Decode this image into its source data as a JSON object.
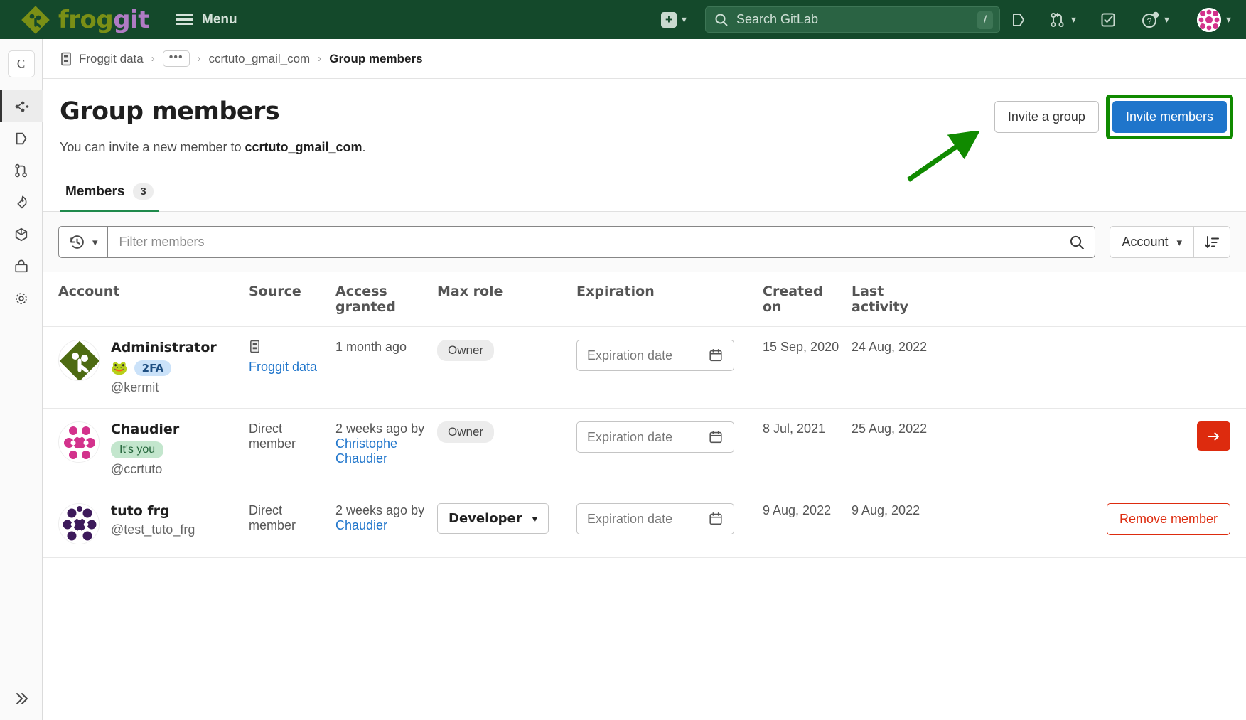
{
  "navbar": {
    "brand_frog": "frog",
    "brand_git": "git",
    "menu_label": "Menu",
    "new_icon": "plus-square-icon",
    "search_placeholder": "Search GitLab",
    "search_value": "",
    "search_shortcut": "/",
    "icons": {
      "issues": "issues-icon",
      "merge_requests": "merge-request-icon",
      "todos": "todo-checkbox-icon",
      "help": "help-question-icon",
      "user_avatar": "user-avatar"
    }
  },
  "sidebar": {
    "context_avatar_letter": "C",
    "items": [
      {
        "name": "group-overview",
        "icon": "group-overview-icon",
        "active": true
      },
      {
        "name": "issues",
        "icon": "issues-icon",
        "active": false
      },
      {
        "name": "merge-requests",
        "icon": "merge-request-icon",
        "active": false
      },
      {
        "name": "ci-cd",
        "icon": "rocket-icon",
        "active": false
      },
      {
        "name": "kubernetes",
        "icon": "package-cube-icon",
        "active": false
      },
      {
        "name": "packages-registries",
        "icon": "package-box-icon",
        "active": false
      },
      {
        "name": "settings",
        "icon": "gear-icon",
        "active": false
      }
    ],
    "collapse_icon": "chevron-double-right-icon"
  },
  "breadcrumb": {
    "icon": "group-icon",
    "items": [
      {
        "label": "Froggit data",
        "current": false
      },
      {
        "label": "•••",
        "current": false,
        "is_ellipsis": true
      },
      {
        "label": "ccrtuto_gmail_com",
        "current": false
      },
      {
        "label": "Group members",
        "current": true
      }
    ],
    "separator": "›"
  },
  "page": {
    "title": "Group members",
    "subtitle_prefix": "You can invite a new member to ",
    "subtitle_group": "ccrtuto_gmail_com",
    "subtitle_suffix": ".",
    "invite_group_label": "Invite a group",
    "invite_members_label": "Invite members",
    "invite_members_color": "#1f75cb",
    "highlight_color": "#108a00"
  },
  "tabs": [
    {
      "label": "Members",
      "count": "3",
      "active": true
    }
  ],
  "filter": {
    "history_icon": "history-clock-icon",
    "placeholder": "Filter members",
    "value": "",
    "search_icon": "search-icon",
    "sort_label": "Account",
    "sort_direction_icon": "sort-descending-icon"
  },
  "table": {
    "columns": [
      "Account",
      "Source",
      "Access granted",
      "Max role",
      "Expiration",
      "Created on",
      "Last activity"
    ],
    "expiration_placeholder": "Expiration date",
    "rows": [
      {
        "name": "Administrator",
        "handle": "@kermit",
        "avatar": "kermit-frog-avatar",
        "badge_2fa": "2FA",
        "badge_you": null,
        "emoji": "🐸",
        "source_label": "Froggit data",
        "source_is_link": true,
        "source_icon": "group-icon",
        "access_granted": "1 month ago",
        "access_granted_by": null,
        "role_type": "pill",
        "role": "Owner",
        "expiration": "",
        "created_on": "15 Sep, 2020",
        "last_activity": "24 Aug, 2022",
        "action": null
      },
      {
        "name": "Chaudier",
        "handle": "@ccrtuto",
        "avatar": "pink-identicon-avatar",
        "badge_2fa": null,
        "badge_you": "It's you",
        "emoji": null,
        "source_label": "Direct member",
        "source_is_link": false,
        "source_icon": null,
        "access_granted": "2 weeks ago by",
        "access_granted_by": "Christophe Chaudier",
        "role_type": "pill",
        "role": "Owner",
        "expiration": "",
        "created_on": "8 Jul, 2021",
        "last_activity": "25 Aug, 2022",
        "action": "leave-group-icon-button"
      },
      {
        "name": "tuto frg",
        "handle": "@test_tuto_frg",
        "avatar": "purple-identicon-avatar",
        "badge_2fa": null,
        "badge_you": null,
        "emoji": null,
        "source_label": "Direct member",
        "source_is_link": false,
        "source_icon": null,
        "access_granted": "2 weeks ago by",
        "access_granted_by": "Chaudier",
        "role_type": "select",
        "role": "Developer",
        "expiration": "",
        "created_on": "9 Aug, 2022",
        "last_activity": "9 Aug, 2022",
        "action": "Remove member"
      }
    ]
  }
}
